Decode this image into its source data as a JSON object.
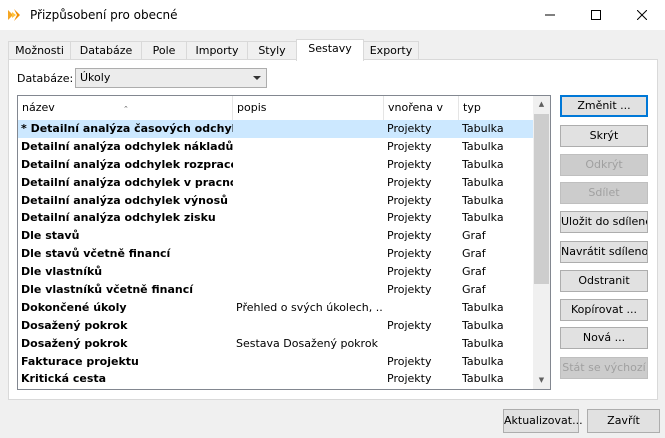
{
  "window": {
    "title": "Přizpůsobení pro obecné",
    "controls": {
      "minimize": "—",
      "maximize": "☐",
      "close": "✕"
    }
  },
  "tabs": [
    {
      "label": "Možnosti"
    },
    {
      "label": "Databáze"
    },
    {
      "label": "Pole"
    },
    {
      "label": "Importy"
    },
    {
      "label": "Styly"
    },
    {
      "label": "Sestavy",
      "active": true
    },
    {
      "label": "Exporty"
    }
  ],
  "database": {
    "label": "Databáze:",
    "selected": "Úkoly"
  },
  "list": {
    "columns": [
      "název",
      "popis",
      "vnořena v",
      "typ"
    ],
    "sort_indicator": "⌃",
    "rows": [
      {
        "name": "* Detailní analýza časových odchylek",
        "desc": "",
        "emb": "Projekty",
        "type": "Tabulka",
        "selected": true
      },
      {
        "name": "Detailní analýza odchylek nákladů",
        "desc": "",
        "emb": "Projekty",
        "type": "Tabulka"
      },
      {
        "name": "Detailní analýza odchylek rozpraco...",
        "desc": "",
        "emb": "Projekty",
        "type": "Tabulka"
      },
      {
        "name": "Detailní analýza odchylek v pracnosti",
        "desc": "",
        "emb": "Projekty",
        "type": "Tabulka"
      },
      {
        "name": "Detailní analýza odchylek výnosů",
        "desc": "",
        "emb": "Projekty",
        "type": "Tabulka"
      },
      {
        "name": "Detailní analýza odchylek zisku",
        "desc": "",
        "emb": "Projekty",
        "type": "Tabulka"
      },
      {
        "name": "Dle stavů",
        "desc": "",
        "emb": "Projekty",
        "type": "Graf"
      },
      {
        "name": "Dle stavů včetně financí",
        "desc": "",
        "emb": "Projekty",
        "type": "Graf"
      },
      {
        "name": "Dle vlastníků",
        "desc": "",
        "emb": "Projekty",
        "type": "Graf"
      },
      {
        "name": "Dle vlastníků včetně financí",
        "desc": "",
        "emb": "Projekty",
        "type": "Graf"
      },
      {
        "name": "Dokončené úkoly",
        "desc": "Přehled o svých úkolech, ...",
        "emb": "",
        "type": "Tabulka"
      },
      {
        "name": "Dosažený pokrok",
        "desc": "",
        "emb": "Projekty",
        "type": "Tabulka"
      },
      {
        "name": "Dosažený pokrok",
        "desc": "Sestava Dosažený pokrok ...",
        "emb": "",
        "type": "Tabulka"
      },
      {
        "name": "Fakturace projektu",
        "desc": "",
        "emb": "Projekty",
        "type": "Tabulka"
      },
      {
        "name": "Kritická cesta",
        "desc": "",
        "emb": "Projekty",
        "type": "Tabulka"
      }
    ],
    "scroll": {
      "up": "▲",
      "down": "▼"
    }
  },
  "side_buttons": [
    {
      "label": "Změnit ...",
      "primary": true
    },
    {
      "label": "Skrýt"
    },
    {
      "label": "Odkrýt",
      "disabled": true
    },
    {
      "label": "Sdílet",
      "disabled": true
    },
    {
      "label": "Uložit do sdílené"
    },
    {
      "label": "Navrátit sdílenou"
    },
    {
      "label": "Odstranit"
    },
    {
      "label": "Kopírovat ..."
    },
    {
      "label": "Nová ..."
    },
    {
      "label": "Stát se výchozí",
      "disabled": true
    }
  ],
  "bottom_buttons": {
    "refresh": "Aktualizovat...",
    "close": "Zavřít"
  },
  "colors": {
    "selection": "#cce8ff",
    "accent": "#0078d7",
    "icon_orange": "#f5a623"
  }
}
